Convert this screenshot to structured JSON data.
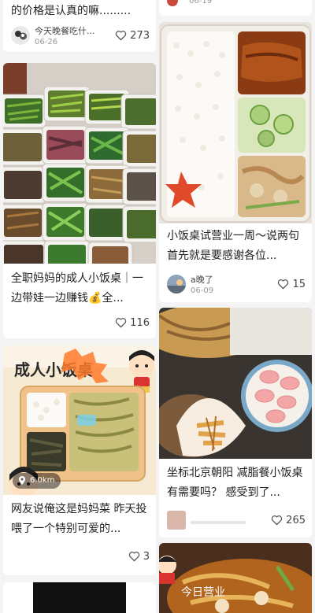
{
  "feed": {
    "left": [
      {
        "title_line": "的价格是认真的嘛.........",
        "author": "今天晚餐吃什...",
        "date": "06-26",
        "likes": "273"
      },
      {
        "title": "全职妈妈的成人小饭桌｜一边带娃一边赚钱💰全...",
        "likes": "116"
      },
      {
        "sign_text": "成人小饭桌",
        "distance": "6.0km",
        "title": "网友说俺这是妈妈菜 昨天投喂了一个特别可爱的...",
        "likes": "3"
      }
    ],
    "right": [
      {
        "date_partial": "06-19"
      },
      {
        "title": "小饭桌试营业一周～说两句 首先就是要感谢各位...",
        "author": "a晚了",
        "date": "06-09",
        "likes": "15"
      },
      {
        "title": "坐标北京朝阳 减脂餐小饭桌有需要吗？ 感受到了...",
        "likes": "265"
      },
      {
        "overlay_text": "今日营业"
      }
    ]
  },
  "icons": {
    "like": "heart-outline-icon",
    "location": "location-pin-icon"
  },
  "colors": {
    "page_bg": "#f4f4f4",
    "card_bg": "#ffffff",
    "text": "#222222",
    "meta_text": "#999999"
  }
}
